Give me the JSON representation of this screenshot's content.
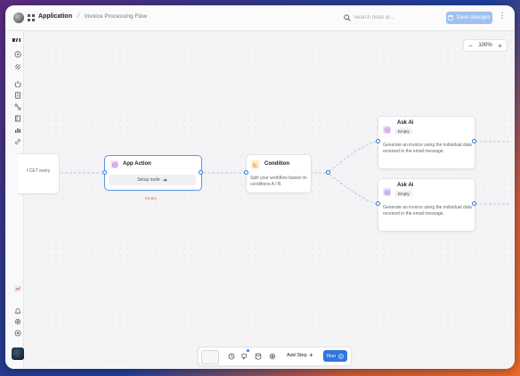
{
  "header": {
    "app_title": "Application",
    "separator": "/",
    "flow_title": "Invoice Processing Flow",
    "search_placeholder": "Search node or...",
    "save_label": "Save changes"
  },
  "canvas": {
    "zoom_level": "100%",
    "zoom_out": "−",
    "zoom_in": "+",
    "partial_node_text": "t CET every",
    "app_action": {
      "title": "App Action",
      "setup_label": "Setup node",
      "status": "Empty"
    },
    "condition": {
      "title": "Condition",
      "description": "Split your workflow based on conditions A / B."
    },
    "ask_ai_1": {
      "title": "Ask Ai",
      "badge": "Empty",
      "description": "Generate an invoice using the individual data received in the email message."
    },
    "ask_ai_2": {
      "title": "Ask Ai",
      "badge": "Empty",
      "description": "Generate an invoice using the individual data received in the email message."
    }
  },
  "sidebar": {
    "logo": "make"
  },
  "toolbar": {
    "add_step_label": "Add Step",
    "run_label": "Run"
  },
  "colors": {
    "accent": "#2f76e0",
    "save_button": "#9ec1f2",
    "empty_status": "#e8702a",
    "condition_icon_bg": "#fde9c8",
    "ai_icon_bg": "#efe2fb",
    "app_action_icon_bg": "#efe2fb"
  }
}
